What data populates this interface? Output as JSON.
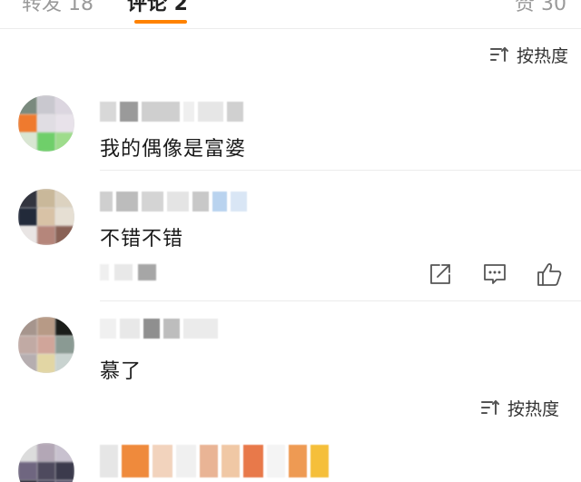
{
  "tabs": {
    "repost_label": "转发 18",
    "comments_label": "评论 2",
    "likes_label": "赞 30"
  },
  "sort": {
    "label": "按热度"
  },
  "comments": [
    {
      "text": "我的偶像是富婆"
    },
    {
      "text": "不错不错"
    },
    {
      "text": "慕了"
    }
  ],
  "colors": {
    "accent": "#ff8200",
    "divider": "#ececec",
    "icon": "#555555"
  },
  "icons": {
    "sort": "sort-icon",
    "share": "share-icon",
    "comment": "comment-icon",
    "like": "thumbs-up-icon"
  }
}
